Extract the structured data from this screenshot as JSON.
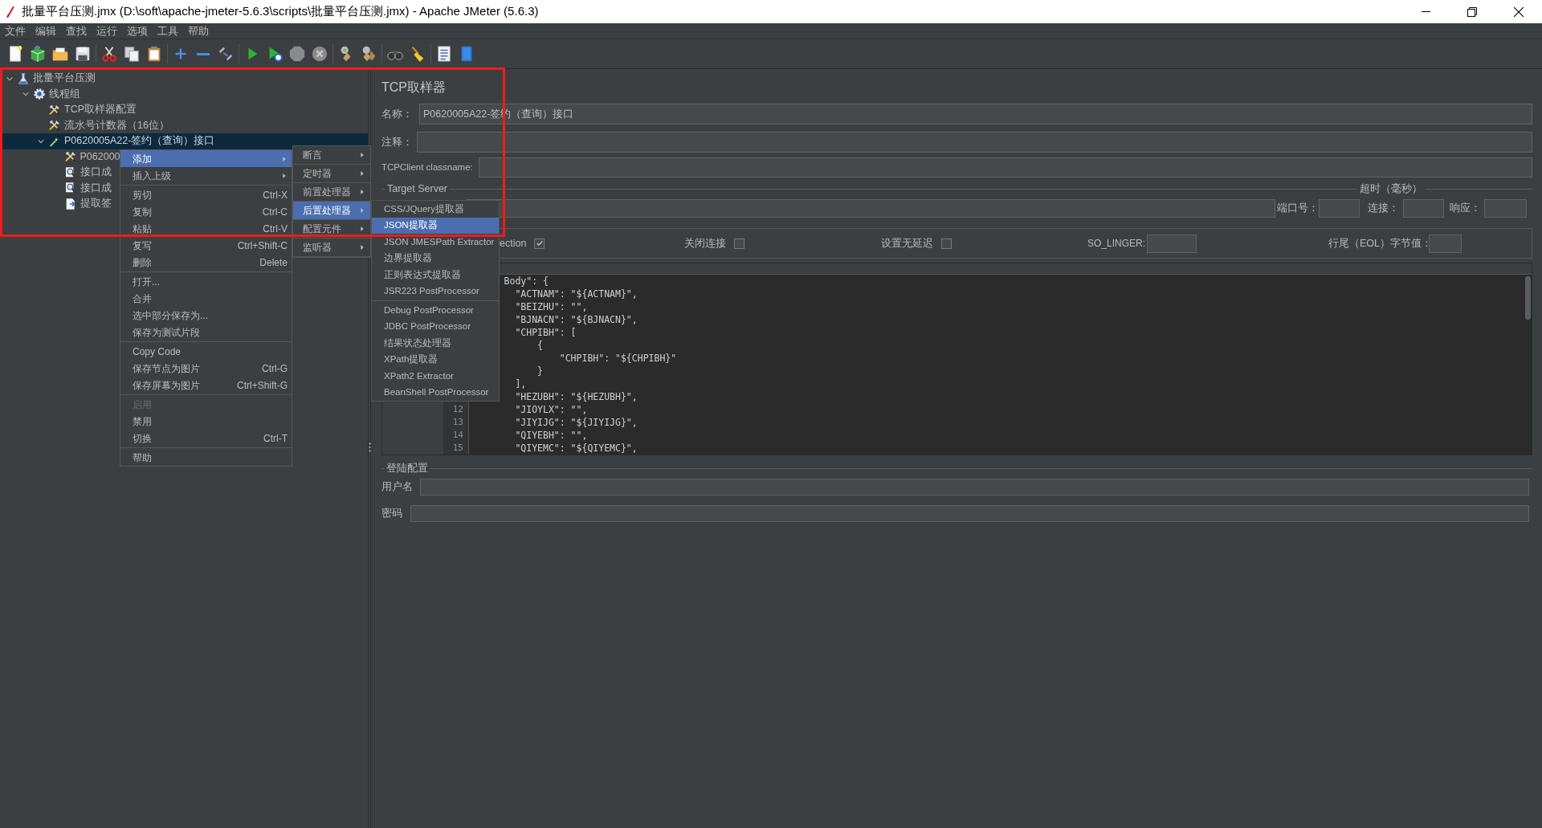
{
  "window": {
    "title": "批量平台压测.jmx (D:\\soft\\apache-jmeter-5.6.3\\scripts\\批量平台压测.jmx) - Apache JMeter (5.6.3)"
  },
  "menu_bar": [
    "文件",
    "编辑",
    "查找",
    "运行",
    "选项",
    "工具",
    "帮助"
  ],
  "tree": [
    {
      "label": "批量平台压测",
      "kind": "flask",
      "expanded": true,
      "selected": false,
      "children": [
        {
          "label": "线程组",
          "kind": "gear",
          "expanded": true,
          "selected": false,
          "children": [
            {
              "label": "TCP取样器配置",
              "kind": "tools",
              "selected": false
            },
            {
              "label": "流水号计数器（16位）",
              "kind": "tools",
              "selected": false
            },
            {
              "label": "P0620005A22-签约（查询）接口",
              "kind": "pipette",
              "expanded": true,
              "selected": true,
              "children": [
                {
                  "label": "P062000",
                  "kind": "tools",
                  "selected": false
                },
                {
                  "label": "接口成",
                  "kind": "magnifier",
                  "selected": false
                },
                {
                  "label": "接口成",
                  "kind": "magnifier",
                  "selected": false
                },
                {
                  "label": "提取签",
                  "kind": "extract",
                  "selected": false
                }
              ]
            }
          ]
        }
      ]
    }
  ],
  "sampler": {
    "title": "TCP取样器",
    "name_label": "名称：",
    "name_value": "P0620005A22-签约（查询）接口",
    "comment_label": "注释：",
    "classname_label": "TCPClient classname:",
    "target_server_label": "Target Server",
    "timeout_label": "超时（毫秒）",
    "port_label": "端口号：",
    "connect_label": "连接：",
    "response_label": "响应：",
    "options": [
      {
        "label": "ection",
        "checked": true
      },
      {
        "label": "关闭连接",
        "checked": false
      },
      {
        "label": "设置无延迟",
        "checked": false
      }
    ],
    "so_linger_label": "SO_LINGER:",
    "eol_label": "行尾（EOL）字节值："
  },
  "request_editor": {
    "lines": [
      {
        "text": "      Body\": {"
      },
      {
        "text": "        \"ACTNAM\": \"${ACTNAM}\","
      },
      {
        "text": "        \"BEIZHU\": \"\","
      },
      {
        "text": "        \"BJNACN\": \"${BJNACN}\","
      },
      {
        "text": "        \"CHPIBH\": ["
      },
      {
        "text": "            {"
      },
      {
        "text": "                \"CHPIBH\": \"${CHPIBH}\""
      },
      {
        "text": "            }"
      },
      {
        "text": "        ],"
      },
      {
        "text": "        \"HEZUBH\": \"${HEZUBH}\","
      },
      {
        "number": "12",
        "text": "        \"JIOYLX\": \"\","
      },
      {
        "number": "13",
        "text": "        \"JIYIJG\": \"${JIYIJG}\","
      },
      {
        "number": "14",
        "text": "        \"QIYEBH\": \"\","
      },
      {
        "number": "15",
        "text": "        \"QIYEMC\": \"${QIYEMC}\","
      }
    ]
  },
  "login_config": {
    "title": "登陆配置",
    "username_label": "用户名",
    "password_label": "密码"
  },
  "context_menu": {
    "sections": [
      {
        "items": [
          {
            "label": "添加",
            "kind": "submenu",
            "selected": true,
            "disabled": false
          },
          {
            "label": "插入上级",
            "kind": "submenu",
            "selected": false,
            "disabled": false
          }
        ]
      },
      {
        "items": [
          {
            "label": "剪切",
            "shortcut": "Ctrl-X",
            "selected": false,
            "disabled": false
          },
          {
            "label": "复制",
            "shortcut": "Ctrl-C",
            "selected": false,
            "disabled": false
          },
          {
            "label": "粘贴",
            "shortcut": "Ctrl-V",
            "selected": false,
            "disabled": false
          },
          {
            "label": "复写",
            "shortcut": "Ctrl+Shift-C",
            "selected": false,
            "disabled": false
          },
          {
            "label": "删除",
            "shortcut": "Delete",
            "selected": false,
            "disabled": false
          }
        ]
      },
      {
        "items": [
          {
            "label": "打开...",
            "selected": false,
            "disabled": false
          },
          {
            "label": "合并",
            "selected": false,
            "disabled": false
          },
          {
            "label": "选中部分保存为...",
            "selected": false,
            "disabled": false
          },
          {
            "label": "保存为测试片段",
            "selected": false,
            "disabled": false
          }
        ]
      },
      {
        "items": [
          {
            "label": "Copy Code",
            "selected": false,
            "disabled": false
          },
          {
            "label": "保存节点为图片",
            "shortcut": "Ctrl-G",
            "selected": false,
            "disabled": false
          },
          {
            "label": "保存屏幕为图片",
            "shortcut": "Ctrl+Shift-G",
            "selected": false,
            "disabled": false
          }
        ]
      },
      {
        "items": [
          {
            "label": "启用",
            "selected": false,
            "disabled": true
          },
          {
            "label": "禁用",
            "selected": false,
            "disabled": false
          },
          {
            "label": "切换",
            "shortcut": "Ctrl-T",
            "selected": false,
            "disabled": false
          }
        ]
      },
      {
        "items": [
          {
            "label": "帮助",
            "selected": false,
            "disabled": false
          }
        ]
      }
    ]
  },
  "add_submenu": {
    "items": [
      {
        "label": "断言",
        "selected": false
      },
      {
        "label": "定时器",
        "selected": false
      },
      {
        "label": "前置处理器",
        "selected": false
      },
      {
        "label": "后置处理器",
        "selected": true
      },
      {
        "label": "配置元件",
        "selected": false
      },
      {
        "label": "监听器",
        "selected": false
      }
    ]
  },
  "postprocessor_submenu": {
    "sections": [
      {
        "items": [
          {
            "label": "CSS/JQuery提取器",
            "selected": false
          },
          {
            "label": "JSON提取器",
            "selected": true
          },
          {
            "label": "JSON JMESPath Extractor",
            "selected": false
          },
          {
            "label": "边界提取器",
            "selected": false
          },
          {
            "label": "正则表达式提取器",
            "selected": false
          },
          {
            "label": "JSR223 PostProcessor",
            "selected": false
          }
        ]
      },
      {
        "items": [
          {
            "label": "Debug PostProcessor",
            "selected": false
          },
          {
            "label": "JDBC PostProcessor",
            "selected": false
          },
          {
            "label": "结果状态处理器",
            "selected": false
          },
          {
            "label": "XPath提取器",
            "selected": false
          },
          {
            "label": "XPath2 Extractor",
            "selected": false
          },
          {
            "label": "BeanShell PostProcessor",
            "selected": false
          }
        ]
      }
    ]
  }
}
